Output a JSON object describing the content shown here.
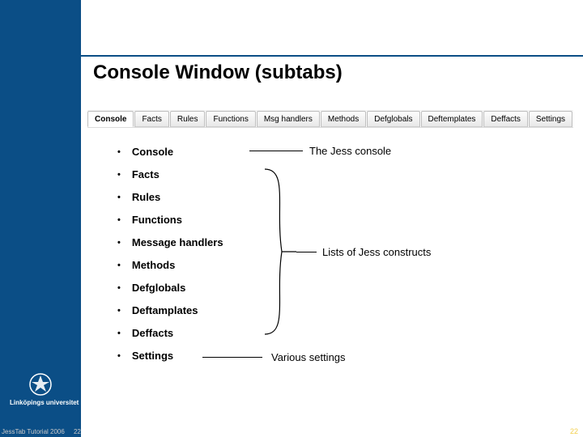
{
  "title": "Console Window (subtabs)",
  "tabs": [
    {
      "label": "Console",
      "active": true
    },
    {
      "label": "Facts",
      "active": false
    },
    {
      "label": "Rules",
      "active": false
    },
    {
      "label": "Functions",
      "active": false
    },
    {
      "label": "Msg handlers",
      "active": false
    },
    {
      "label": "Methods",
      "active": false
    },
    {
      "label": "Defglobals",
      "active": false
    },
    {
      "label": "Deftemplates",
      "active": false
    },
    {
      "label": "Deffacts",
      "active": false
    },
    {
      "label": "Settings",
      "active": false
    }
  ],
  "items": [
    "Console",
    "Facts",
    "Rules",
    "Functions",
    "Message handlers",
    "Methods",
    "Defglobals",
    "Deftamplates",
    "Deffacts",
    "Settings"
  ],
  "annotations": {
    "console": "The Jess console",
    "group": "Lists of Jess constructs",
    "settings": "Various settings"
  },
  "footer": {
    "left_a": "JessTab Tutorial 2006",
    "left_b": "22",
    "right": "22"
  },
  "brand": "Linköpings universitet"
}
